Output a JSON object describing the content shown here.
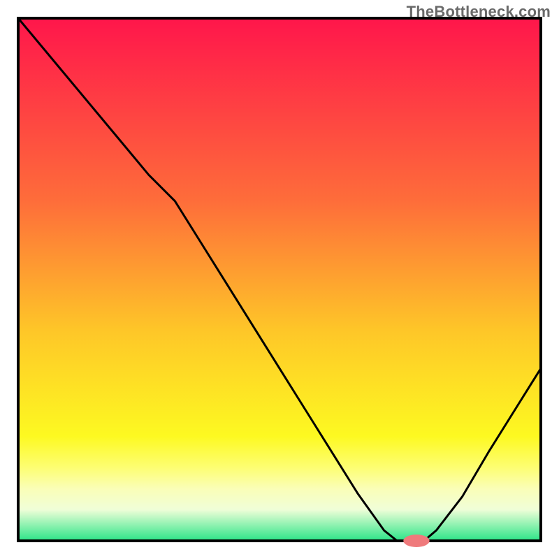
{
  "watermark": "TheBottleneck.com",
  "colors": {
    "frame": "#000000",
    "line": "#000000",
    "marker_fill": "#ef7a7c",
    "marker_stroke": "none",
    "gradient_top": "#ff164b",
    "gradient_35": "#fe6d3a",
    "gradient_60": "#fec728",
    "gradient_80": "#fdf921",
    "gradient_86": "#fdfe73",
    "gradient_90": "#fafeb7",
    "gradient_94": "#f0fed8",
    "gradient_bottom": "#2be588"
  },
  "chart_data": {
    "type": "line",
    "title": "",
    "xlabel": "",
    "ylabel": "",
    "x": [
      0.0,
      0.05,
      0.1,
      0.15,
      0.2,
      0.25,
      0.3,
      0.35,
      0.4,
      0.45,
      0.5,
      0.55,
      0.6,
      0.65,
      0.7,
      0.725,
      0.75,
      0.775,
      0.78,
      0.8,
      0.85,
      0.9,
      0.95,
      1.0
    ],
    "values": [
      1.0,
      0.94,
      0.88,
      0.82,
      0.76,
      0.7,
      0.65,
      0.57,
      0.49,
      0.41,
      0.33,
      0.25,
      0.17,
      0.09,
      0.02,
      0.0,
      0.0,
      0.0,
      0.003,
      0.02,
      0.085,
      0.17,
      0.25,
      0.33
    ],
    "xlim": [
      0,
      1
    ],
    "ylim": [
      0,
      1
    ],
    "marker": {
      "x": 0.762,
      "y": 0.0,
      "rx": 0.025,
      "ry": 0.012
    },
    "inflection_note": "slope changes around x≈0.25 (gentler above, steeper below); minimum plateau near x≈0.70–0.78; rises again toward x=1"
  }
}
